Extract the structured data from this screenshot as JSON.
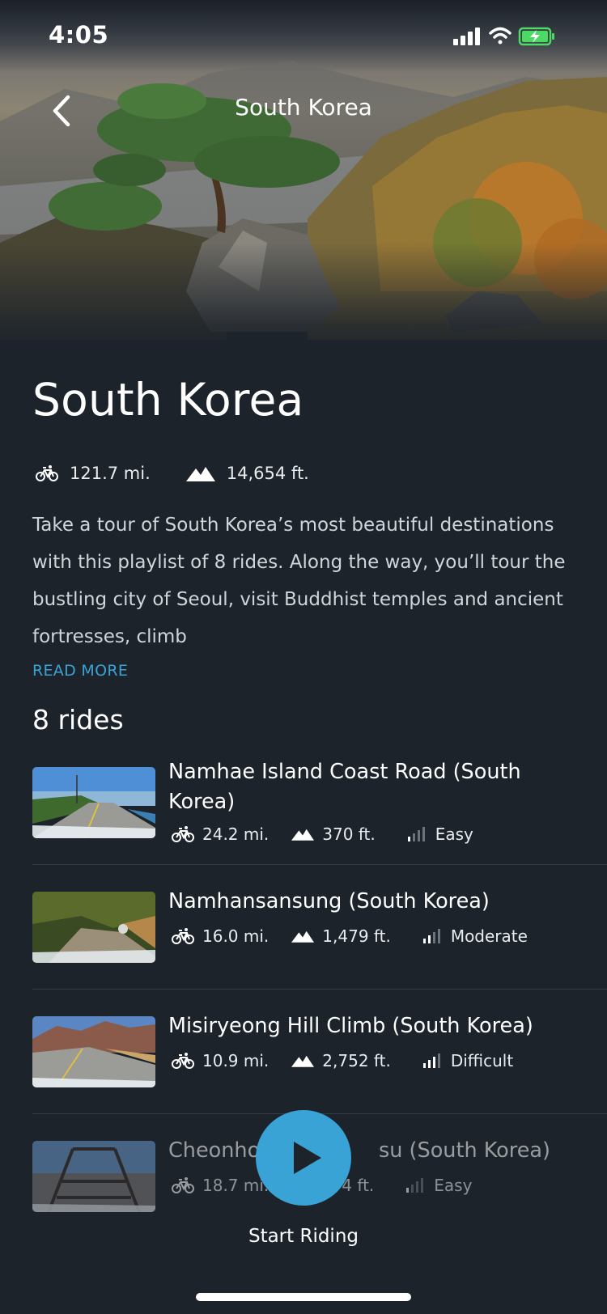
{
  "status_bar": {
    "time": "4:05"
  },
  "nav": {
    "title": "South Korea",
    "back_icon": "chevron-left-icon"
  },
  "hero": {
    "image": "mountain landscape with pine tree on rocks"
  },
  "playlist": {
    "title": "South Korea",
    "distance": "121.7 mi.",
    "elevation": "14,654 ft.",
    "description": "Take a tour of South Korea’s most beautiful destinations with this playlist of 8 rides. Along the way, you’ll tour the bustling city of Seoul, visit Buddhist temples and ancient fortresses, climb",
    "read_more": "READ MORE",
    "rides_heading": "8 rides"
  },
  "rides": [
    {
      "name": "Namhae Island Coast Road (South Korea)",
      "distance": "24.2 mi.",
      "elevation": "370 ft.",
      "difficulty": "Easy",
      "difficulty_level": 1
    },
    {
      "name": "Namhansansung (South Korea)",
      "distance": "16.0 mi.",
      "elevation": "1,479 ft.",
      "difficulty": "Moderate",
      "difficulty_level": 2
    },
    {
      "name": "Misiryeong Hill Climb (South Korea)",
      "distance": "10.9 mi.",
      "elevation": "2,752 ft.",
      "difficulty": "Difficult",
      "difficulty_level": 3
    },
    {
      "name": "Cheonho ... su (South Korea)",
      "name_left": "Cheonho",
      "name_right": "su (South Korea)",
      "distance": "18.7 mi.",
      "elevation": "4 ft.",
      "difficulty": "Easy",
      "difficulty_level": 1
    }
  ],
  "cta": {
    "label": "Start Riding",
    "icon": "play-icon"
  },
  "colors": {
    "background": "#1d232b",
    "accent": "#3aa3d6",
    "divider": "#353c46",
    "battery": "#4cd964"
  }
}
